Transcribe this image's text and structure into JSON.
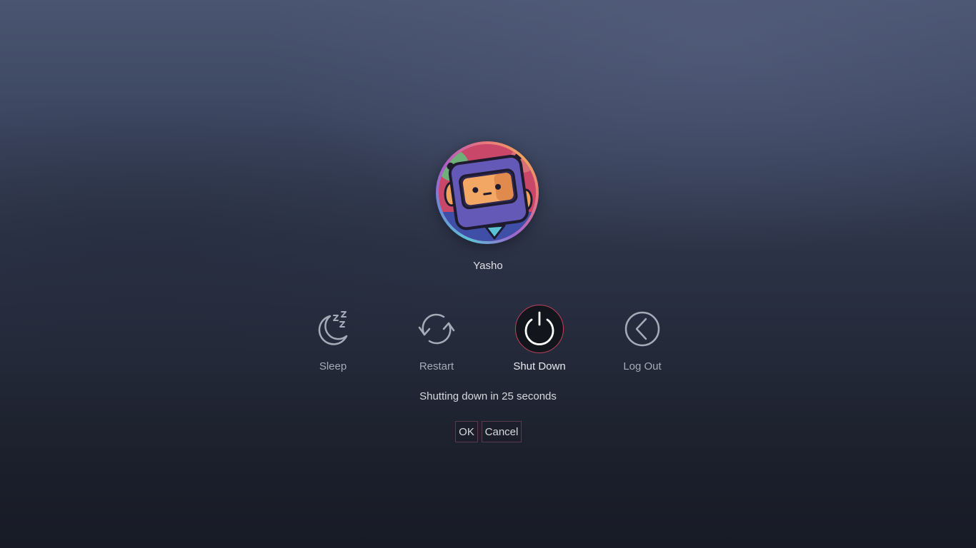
{
  "user": {
    "name": "Yasho"
  },
  "actions": [
    {
      "id": "sleep",
      "label": "Sleep",
      "icon": "sleep-moon-icon",
      "active": false
    },
    {
      "id": "restart",
      "label": "Restart",
      "icon": "restart-icon",
      "active": false
    },
    {
      "id": "shutdown",
      "label": "Shut Down",
      "icon": "power-icon",
      "active": true
    },
    {
      "id": "logout",
      "label": "Log Out",
      "icon": "logout-arrow-icon",
      "active": false
    }
  ],
  "status": {
    "countdown_text": "Shutting down in 25 seconds"
  },
  "buttons": {
    "ok_label": "OK",
    "cancel_label": "Cancel"
  },
  "colors": {
    "active_ring": "#c2415b",
    "active_fill": "#13151d",
    "icon_inactive": "#a6abb8",
    "icon_active": "#ffffff"
  }
}
